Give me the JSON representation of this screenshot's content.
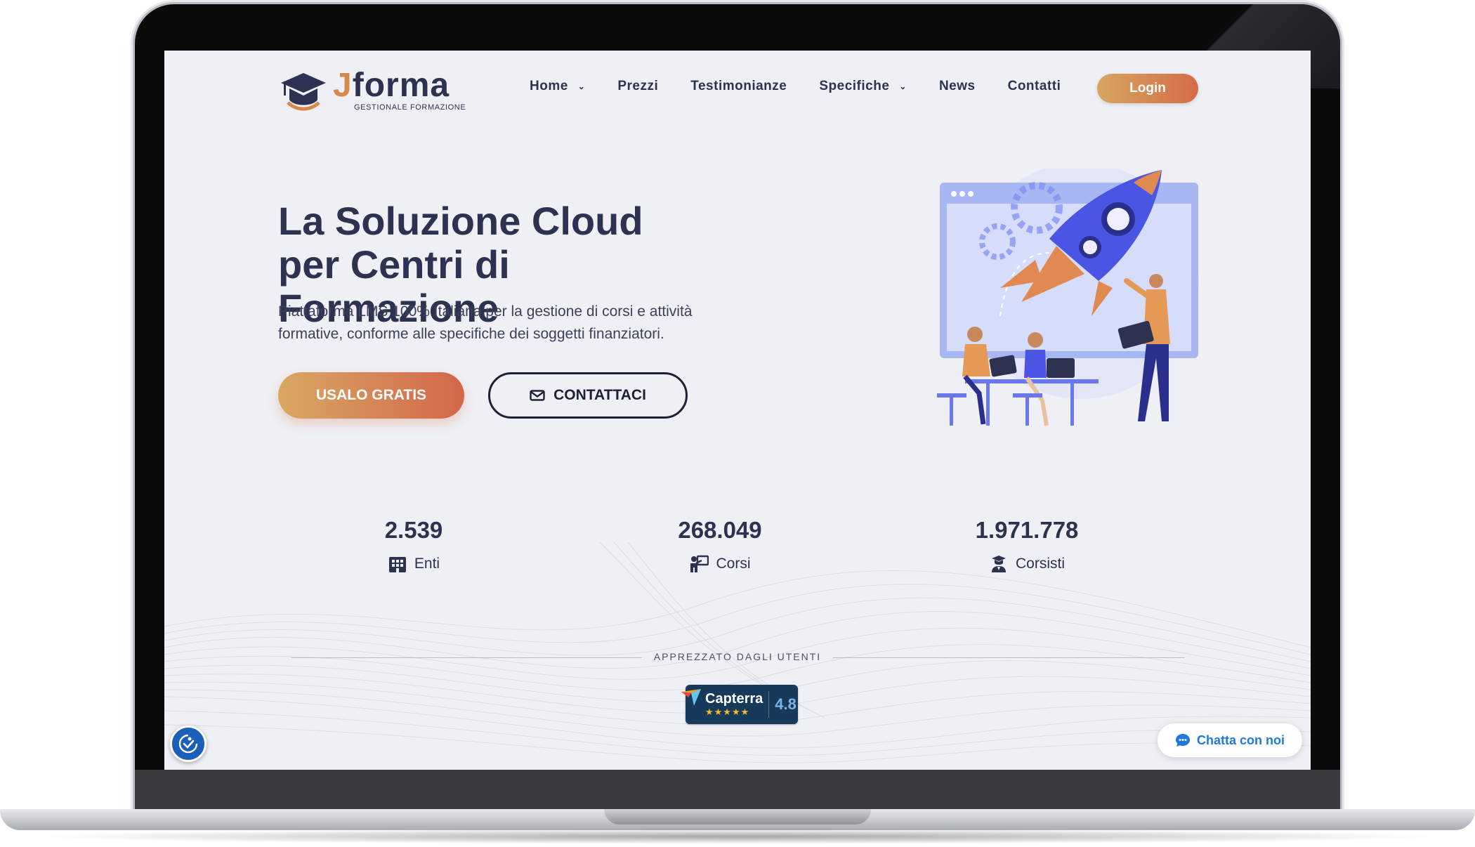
{
  "brand": {
    "name_accent": "J",
    "name_rest": "forma",
    "tagline": "GESTIONALE FORMAZIONE",
    "accent_color": "#d7894a",
    "primary_color": "#2d3250"
  },
  "nav": {
    "items": [
      {
        "label": "Home",
        "has_dropdown": true
      },
      {
        "label": "Prezzi",
        "has_dropdown": false
      },
      {
        "label": "Testimonianze",
        "has_dropdown": false
      },
      {
        "label": "Specifiche",
        "has_dropdown": true
      },
      {
        "label": "News",
        "has_dropdown": false
      },
      {
        "label": "Contatti",
        "has_dropdown": false
      }
    ],
    "login_label": "Login"
  },
  "hero": {
    "title": "La Soluzione Cloud per Centri di Formazione",
    "subtitle": "Piattaforma LMS 100% Italiana per la gestione di corsi e attività formative, conforme alle specifiche dei soggetti finanziatori.",
    "primary_button": "USALO GRATIS",
    "secondary_button": "CONTATTACI",
    "secondary_icon": "envelope-icon",
    "illustration": "rocket-team-illustration"
  },
  "stats": [
    {
      "value": "2.539",
      "label": "Enti",
      "icon": "building-icon"
    },
    {
      "value": "268.049",
      "label": "Corsi",
      "icon": "teacher-board-icon"
    },
    {
      "value": "1.971.778",
      "label": "Corsisti",
      "icon": "graduate-user-icon"
    }
  ],
  "rating": {
    "caption": "APPREZZATO DAGLI UTENTI",
    "badge_name": "Capterra",
    "score": "4.8",
    "stars": "★★★★★"
  },
  "widgets": {
    "chat_label": "Chatta con noi",
    "chat_icon": "chat-bubble-icon",
    "accessibility_icon": "accessibility-icon"
  }
}
